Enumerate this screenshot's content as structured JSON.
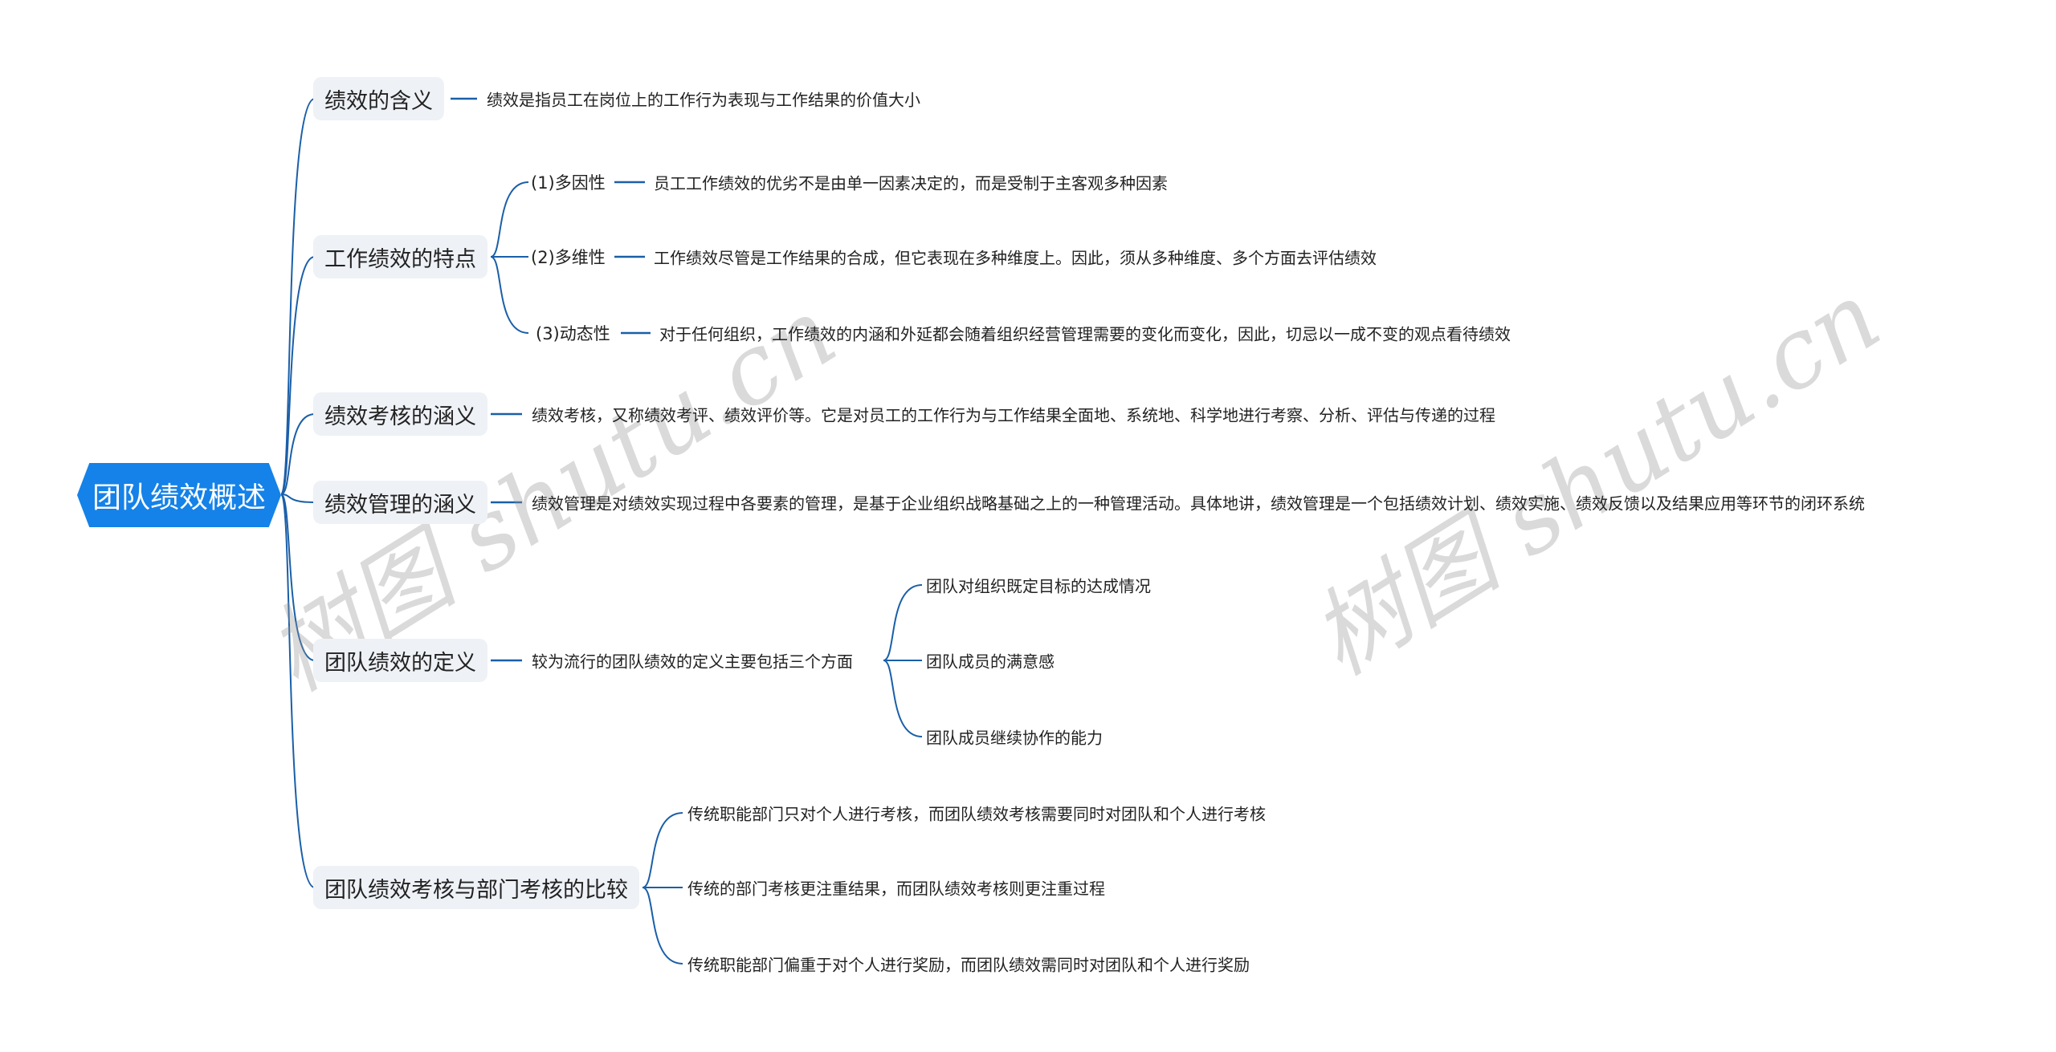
{
  "root": {
    "label": "团队绩效概述"
  },
  "branches": [
    {
      "label": "绩效的含义",
      "children": [
        {
          "label": "绩效是指员工在岗位上的工作行为表现与工作结果的价值大小"
        }
      ]
    },
    {
      "label": "工作绩效的特点",
      "children": [
        {
          "label": "(1)多因性",
          "detail": "员工工作绩效的优劣不是由单一因素决定的，而是受制于主客观多种因素"
        },
        {
          "label": "(2)多维性",
          "detail": "工作绩效尽管是工作结果的合成，但它表现在多种维度上。因此，须从多种维度、多个方面去评估绩效"
        },
        {
          "label": "(3)动态性",
          "detail": "对于任何组织，工作绩效的内涵和外延都会随着组织经营管理需要的变化而变化，因此，切忌以一成不变的观点看待绩效"
        }
      ]
    },
    {
      "label": "绩效考核的涵义",
      "children": [
        {
          "label": "绩效考核，又称绩效考评、绩效评价等。它是对员工的工作行为与工作结果全面地、系统地、科学地进行考察、分析、评估与传递的过程"
        }
      ]
    },
    {
      "label": "绩效管理的涵义",
      "children": [
        {
          "label": "绩效管理是对绩效实现过程中各要素的管理，是基于企业组织战略基础之上的一种管理活动。具体地讲，绩效管理是一个包括绩效计划、绩效实施、绩效反馈以及结果应用等环节的闭环系统"
        }
      ]
    },
    {
      "label": "团队绩效的定义",
      "children": [
        {
          "label": "较为流行的团队绩效的定义主要包括三个方面",
          "children": [
            {
              "label": "团队对组织既定目标的达成情况"
            },
            {
              "label": "团队成员的满意感"
            },
            {
              "label": "团队成员继续协作的能力"
            }
          ]
        }
      ]
    },
    {
      "label": "团队绩效考核与部门考核的比较",
      "children": [
        {
          "label": "传统职能部门只对个人进行考核，而团队绩效考核需要同时对团队和个人进行考核"
        },
        {
          "label": "传统的部门考核更注重结果，而团队绩效考核则更注重过程"
        },
        {
          "label": "传统职能部门偏重于对个人进行奖励，而团队绩效需同时对团队和个人进行奖励"
        }
      ]
    }
  ],
  "watermarks": [
    "树图 shutu.cn",
    "树图 shutu.cn"
  ],
  "colors": {
    "root": "#1482e8",
    "line": "#1a5fa8",
    "node_bg": "#eef1f5"
  }
}
